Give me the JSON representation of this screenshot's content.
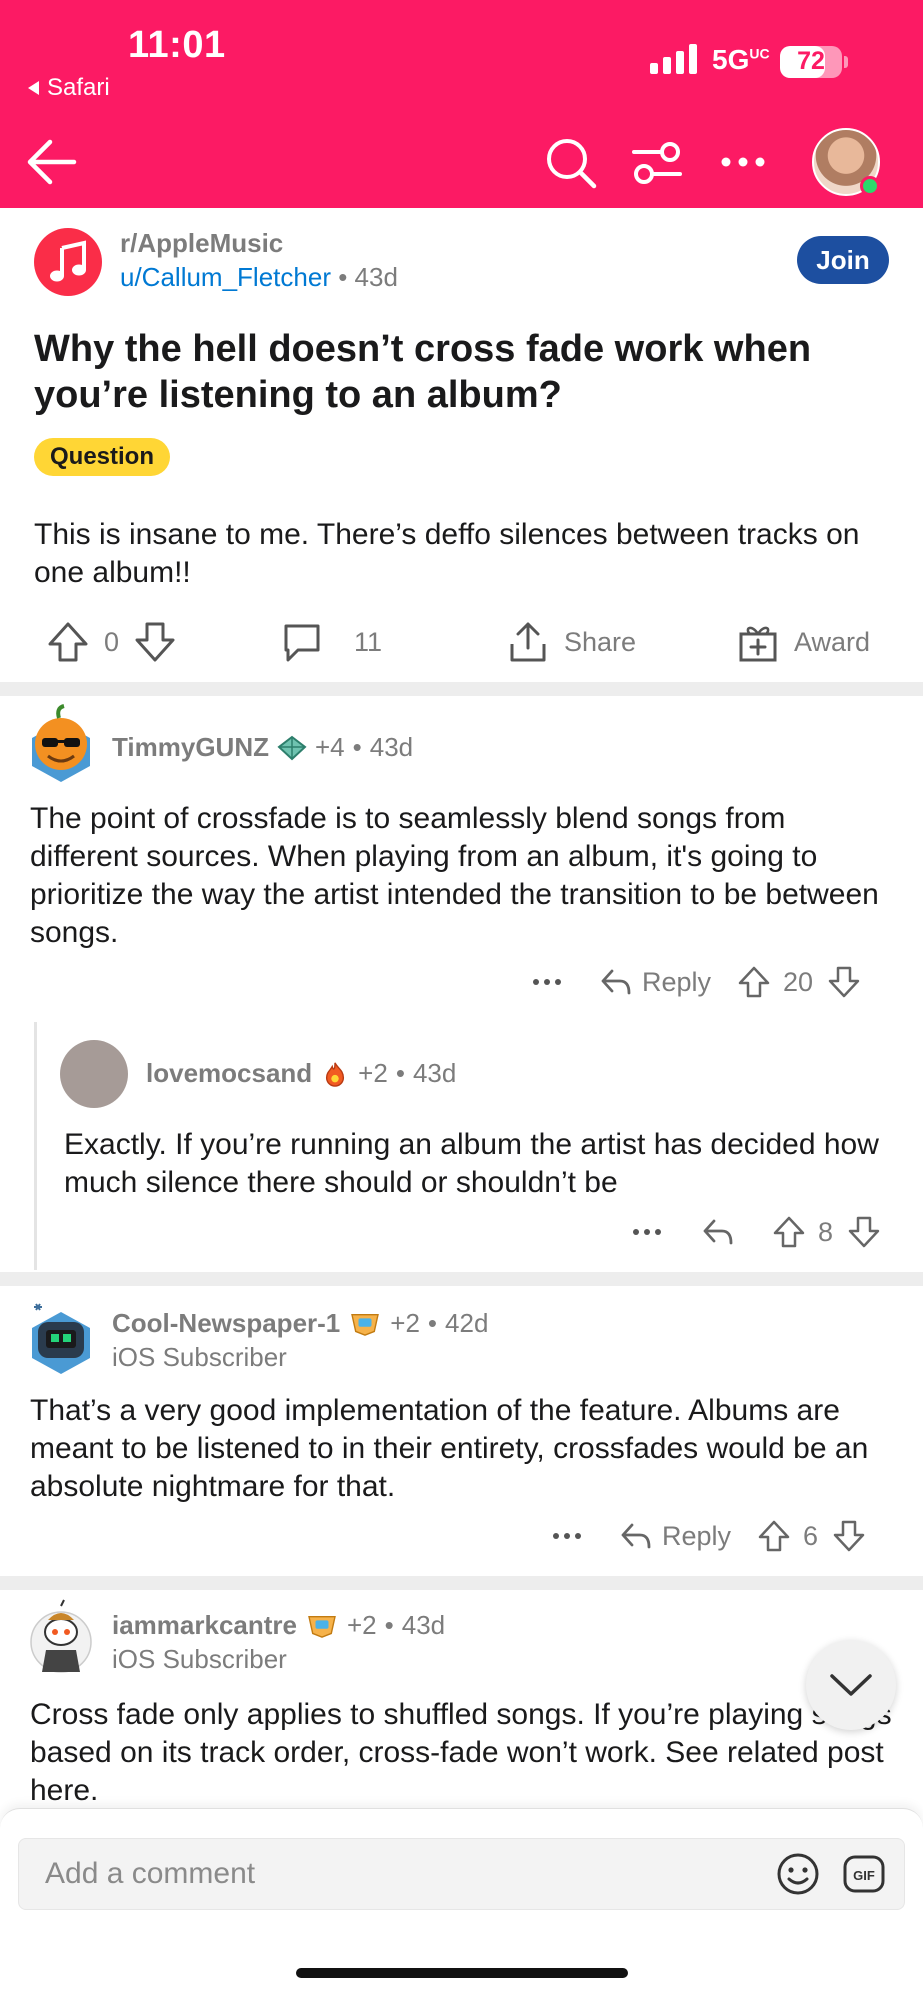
{
  "status_bar": {
    "time": "11:01",
    "back_app": "Safari",
    "network": "5G",
    "network_sup": "UC",
    "battery": "72",
    "battery_fraction": 0.72
  },
  "post": {
    "subreddit": "r/AppleMusic",
    "author": "u/Callum_Fletcher",
    "age": "43d",
    "join_label": "Join",
    "title": "Why the hell doesn’t cross fade work when you’re listening to an album?",
    "flair": "Question",
    "body": "This is insane to me. There’s deffo silences between tracks on one album!!",
    "score": "0",
    "comments_count": "11",
    "share_label": "Share",
    "award_label": "Award"
  },
  "comments": [
    {
      "username": "TimmyGUNZ",
      "karma": "+4",
      "age": "43d",
      "body": "The point of crossfade is to seamlessly blend songs from different sources. When playing from an album, it's going to prioritize the way the artist intended the transition to be between songs.",
      "reply_label": "Reply",
      "score": "20"
    },
    {
      "username": "lovemocsand",
      "karma": "+2",
      "age": "43d",
      "body": "Exactly. If you’re running an album the artist has decided how much silence there should or shouldn’t be",
      "score": "8"
    },
    {
      "username": "Cool-Newspaper-1",
      "karma": "+2",
      "age": "42d",
      "flair": "iOS Subscriber",
      "body": "That’s a very good implementation of the feature. Albums are meant to be listened to in their entirety, crossfades would be an absolute nightmare for that.",
      "reply_label": "Reply",
      "score": "6"
    },
    {
      "username": "iammarkcantre",
      "karma": "+2",
      "age": "43d",
      "flair": "iOS Subscriber",
      "body": "Cross fade only applies to shuffled songs. If you’re playing songs based on its track order, cross-fade won’t work. See related post here."
    }
  ],
  "composer": {
    "placeholder": "Add a comment"
  },
  "colors": {
    "header": "#fc1a64",
    "join": "#1d4fa0",
    "flair": "#ffd635",
    "author_link": "#0079d3"
  }
}
